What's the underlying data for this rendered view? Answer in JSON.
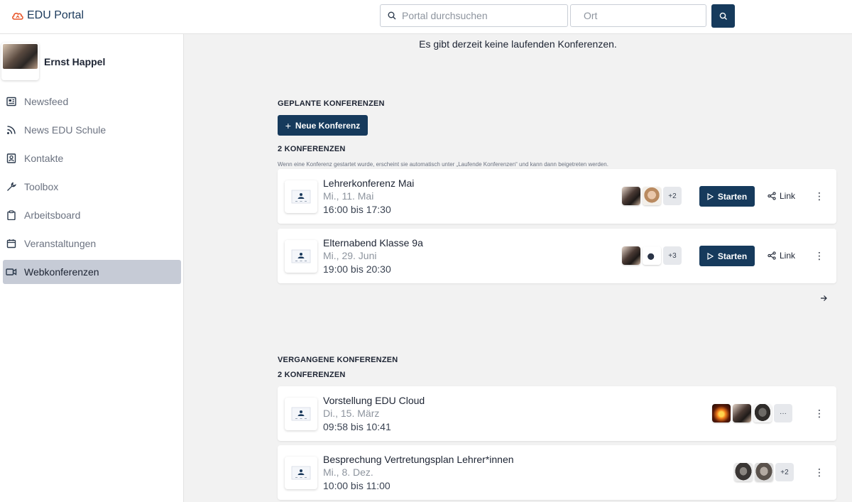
{
  "app": {
    "logo_text": "EDU Portal"
  },
  "search": {
    "query_placeholder": "Portal durchsuchen",
    "location_placeholder": "Ort"
  },
  "user": {
    "name": "Ernst Happel"
  },
  "sidebar": {
    "items": [
      {
        "label": "Newsfeed",
        "icon": "newspaper-icon"
      },
      {
        "label": "News EDU Schule",
        "icon": "rss-icon"
      },
      {
        "label": "Kontakte",
        "icon": "contact-icon"
      },
      {
        "label": "Toolbox",
        "icon": "wrench-icon"
      },
      {
        "label": "Arbeitsboard",
        "icon": "clipboard-icon"
      },
      {
        "label": "Veranstaltungen",
        "icon": "calendar-icon"
      },
      {
        "label": "Webkonferenzen",
        "icon": "video-icon",
        "active": true
      }
    ]
  },
  "running": {
    "empty_text": "Es gibt derzeit keine laufenden Konferenzen."
  },
  "planned": {
    "title": "GEPLANTE KONFERENZEN",
    "new_button": "Neue Konferenz",
    "count": "2 KONFERENZEN",
    "note": "Wenn eine Konferenz gestartet wurde, erscheint sie automatisch unter „Laufende Konferenzen“ und kann dann beigetreten werden.",
    "items": [
      {
        "title": "Lehrerkonferenz Mai",
        "date": "Mi., 11. Mai",
        "time": "16:00 bis 17:30",
        "more": "+2",
        "start": "Starten",
        "link": "Link"
      },
      {
        "title": "Elternabend Klasse 9a",
        "date": "Mi., 29. Juni",
        "time": "19:00 bis 20:30",
        "more": "+3",
        "start": "Starten",
        "link": "Link"
      }
    ]
  },
  "past": {
    "title": "VERGANGENE KONFERENZEN",
    "count": "2 KONFERENZEN",
    "items": [
      {
        "title": "Vorstellung EDU Cloud",
        "date": "Di., 15. März",
        "time": "09:58 bis 10:41",
        "more": "···"
      },
      {
        "title": "Besprechung Vertretungsplan Lehrer*innen",
        "date": "Mi., 8. Dez.",
        "time": "10:00 bis 11:00",
        "more": "+2"
      }
    ]
  },
  "colors": {
    "primary": "#163a5c",
    "logo_accent": "#e8572b",
    "active_nav": "#c6cbd6"
  }
}
